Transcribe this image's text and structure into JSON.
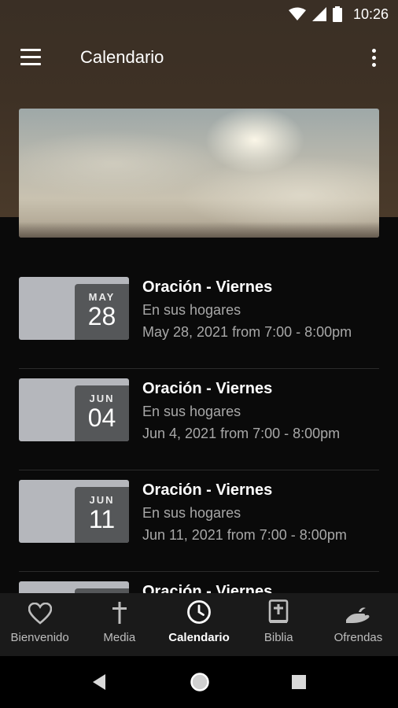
{
  "status_bar": {
    "time": "10:26"
  },
  "app_bar": {
    "title": "Calendario"
  },
  "events": [
    {
      "month": "MAY",
      "day": "28",
      "title": "Oración - Viernes",
      "location": "En sus hogares",
      "datetime": "May 28, 2021 from 7:00 - 8:00pm"
    },
    {
      "month": "JUN",
      "day": "04",
      "title": "Oración - Viernes",
      "location": "En sus hogares",
      "datetime": "Jun 4, 2021 from 7:00 - 8:00pm"
    },
    {
      "month": "JUN",
      "day": "11",
      "title": "Oración - Viernes",
      "location": "En sus hogares",
      "datetime": "Jun 11, 2021 from 7:00 - 8:00pm"
    },
    {
      "month": "",
      "day": "",
      "title": "Oración - Viernes",
      "location": "",
      "datetime": ""
    }
  ],
  "bottom_nav": [
    {
      "label": "Bienvenido",
      "icon": "heart-icon"
    },
    {
      "label": "Media",
      "icon": "cross-icon"
    },
    {
      "label": "Calendario",
      "icon": "clock-icon",
      "active": true
    },
    {
      "label": "Biblia",
      "icon": "bible-icon"
    },
    {
      "label": "Ofrendas",
      "icon": "giving-hand-icon"
    }
  ],
  "colors": {
    "header_brown": "#3e3125",
    "background": "#0a0a0a",
    "nav_background": "#1a1a1a",
    "calendar_tile": "#b5b7bc",
    "calendar_box": "#555759"
  }
}
